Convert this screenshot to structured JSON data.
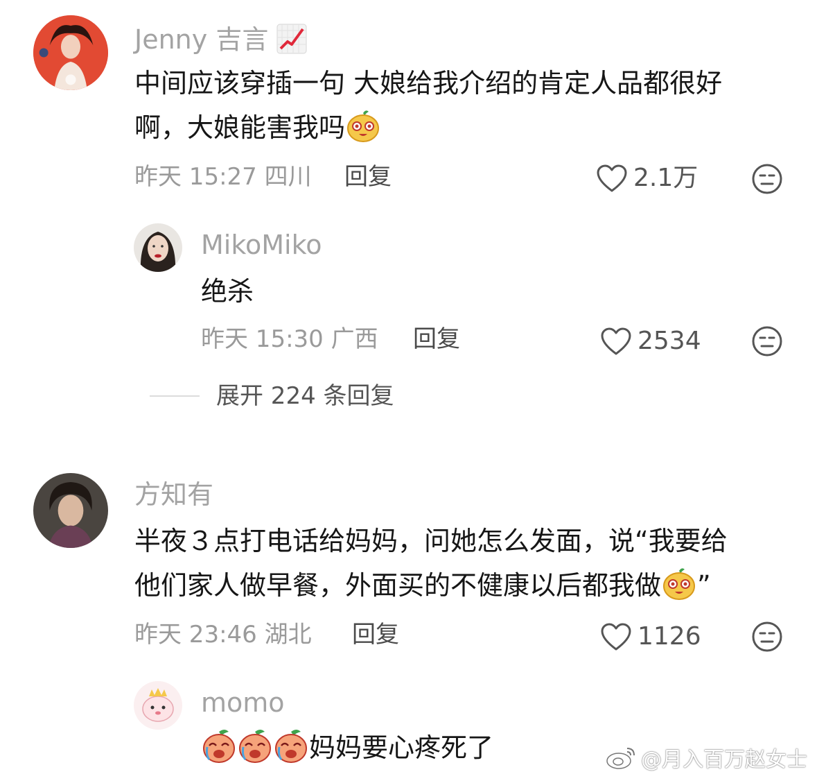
{
  "comments": [
    {
      "username": "Jenny 吉言",
      "content_line1": "中间应该穿插一句 大娘给我介绍的肯定人品都很好",
      "content_line2": "啊，大娘能害我吗",
      "time": "昨天 15:27",
      "location": "四川",
      "reply_label": "回复",
      "likes": "2.1万",
      "replies": [
        {
          "username": "MikoMiko",
          "content": "绝杀",
          "time": "昨天 15:30",
          "location": "广西",
          "reply_label": "回复",
          "likes": "2534"
        }
      ],
      "expand_label": "展开 224 条回复"
    },
    {
      "username": "方知有",
      "content_line1": "半夜３点打电话给妈妈，问她怎么发面，说“我要给",
      "content_line2": "他们家人做早餐，外面买的不健康以后都我做",
      "content_line2_suffix": "”",
      "time": "昨天 23:46",
      "location": "湖北",
      "reply_label": "回复",
      "likes": "1126",
      "replies": [
        {
          "username": "momo",
          "content": "妈妈要心疼死了"
        }
      ]
    }
  ],
  "watermark": "@月入百万赵女士",
  "colors": {
    "username": "#a3a3a3",
    "meta": "#9a9a9a",
    "text": "#161616"
  }
}
